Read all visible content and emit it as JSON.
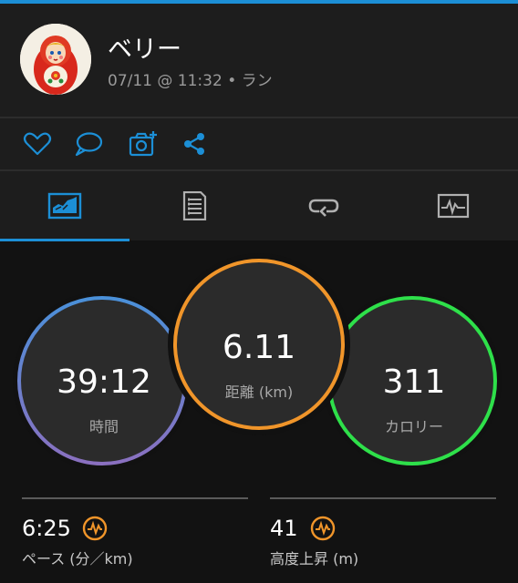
{
  "activity": {
    "user_name": "ベリー",
    "meta": "07/11 @ 11:32 • ラン"
  },
  "actions": {
    "icons": [
      "heart-icon",
      "comment-icon",
      "add-photo-icon",
      "share-icon"
    ],
    "accent": "#1c8fd6"
  },
  "tabs": {
    "icons": [
      "summary-chart-icon",
      "details-document-icon",
      "laps-loop-icon",
      "graph-monitor-icon"
    ],
    "selected_index": 0
  },
  "stats": {
    "time": {
      "value": "39:12",
      "label": "時間",
      "ring_color": "#4a90d9"
    },
    "distance": {
      "value": "6.11",
      "label": "距離 (km)",
      "ring_color": "#f0952a"
    },
    "calories": {
      "value": "311",
      "label": "カロリー",
      "ring_color": "#2ee04a"
    }
  },
  "metrics": {
    "pace": {
      "value": "6:25",
      "label": "ペース (分／km)"
    },
    "elevation": {
      "value": "41",
      "label": "高度上昇 (m)"
    },
    "icon_color": "#f0952a"
  }
}
